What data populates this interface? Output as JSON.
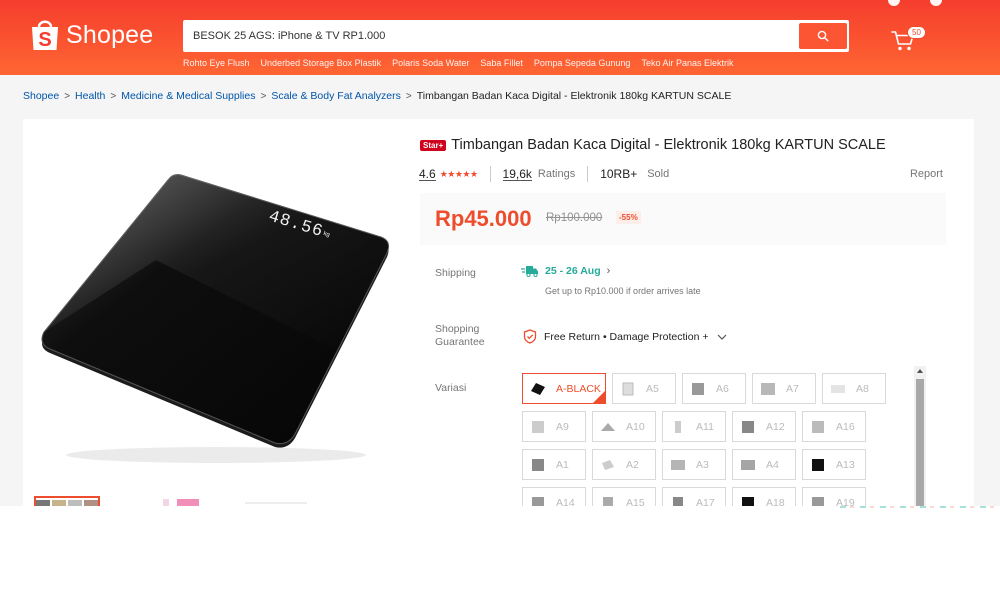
{
  "header": {
    "logo_text": "Shopee",
    "search_value": "BESOK 25 AGS: iPhone & TV RP1.000",
    "search_hints": [
      "Rohto Eye Flush",
      "Underbed Storage Box Plastik",
      "Polaris Soda Water",
      "Saba Fillet",
      "Pompa Sepeda Gunung",
      "Teko Air Panas Elektrik"
    ],
    "cart_count": "50",
    "icons": {
      "search": "search-icon",
      "cart": "cart-icon",
      "logo": "shopee-bag-icon"
    },
    "colors": {
      "brand": "#ee4d2d",
      "header_start": "#f53d2d",
      "header_end": "#ff6633"
    }
  },
  "breadcrumb": {
    "items": [
      "Shopee",
      "Health",
      "Medicine & Medical Supplies",
      "Scale & Body Fat Analyzers"
    ],
    "current": "Timbangan Badan Kaca Digital - Elektronik 180kg KARTUN SCALE"
  },
  "product": {
    "badge": "Star+",
    "title": "Timbangan Badan Kaca Digital - Elektronik 180kg KARTUN SCALE",
    "rating": "4.6",
    "rating_stars": "★★★★★",
    "ratings_count": "19,6k",
    "ratings_label": "Ratings",
    "sold_count": "10RB+",
    "sold_label": "Sold",
    "report_label": "Report",
    "price": "Rp45.000",
    "original_price": "Rp100.000",
    "discount": "-55%",
    "scale_display": "48.56",
    "scale_unit": "kg"
  },
  "shipping": {
    "label": "Shipping",
    "date": "25 - 26 Aug",
    "note": "Get up to Rp10.000 if order arrives late"
  },
  "guarantee": {
    "label_line1": "Shopping",
    "label_line2": "Guarantee",
    "text": "Free Return • Damage Protection +"
  },
  "variants": {
    "label": "Variasi",
    "selected": "A-BLACK",
    "rows": [
      [
        "A-BLACK",
        "A5",
        "A6",
        "A7",
        "A8"
      ],
      [
        "A9",
        "A10",
        "A11",
        "A12",
        "A16"
      ],
      [
        "A1",
        "A2",
        "A3",
        "A4",
        "A13"
      ],
      [
        "A14",
        "A15",
        "A17",
        "A18",
        "A19"
      ]
    ]
  }
}
